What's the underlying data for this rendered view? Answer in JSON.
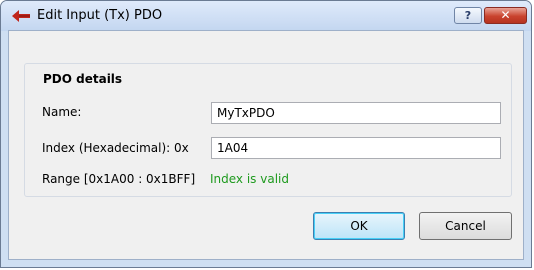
{
  "window": {
    "title": "Edit Input (Tx) PDO",
    "title_icon": "arrow-left-icon",
    "help_label": "?",
    "close_label": "✕"
  },
  "group": {
    "title": "PDO details"
  },
  "form": {
    "name_label": "Name:",
    "name_value": "MyTxPDO",
    "index_label": "Index (Hexadecimal): 0x",
    "index_value": "1A04",
    "range_label": "Range [0x1A00 : 0x1BFF]",
    "status_text": "Index is valid"
  },
  "buttons": {
    "ok": "OK",
    "cancel": "Cancel"
  },
  "colors": {
    "status_valid": "#1e9a1e",
    "title_icon": "#c0251b"
  }
}
